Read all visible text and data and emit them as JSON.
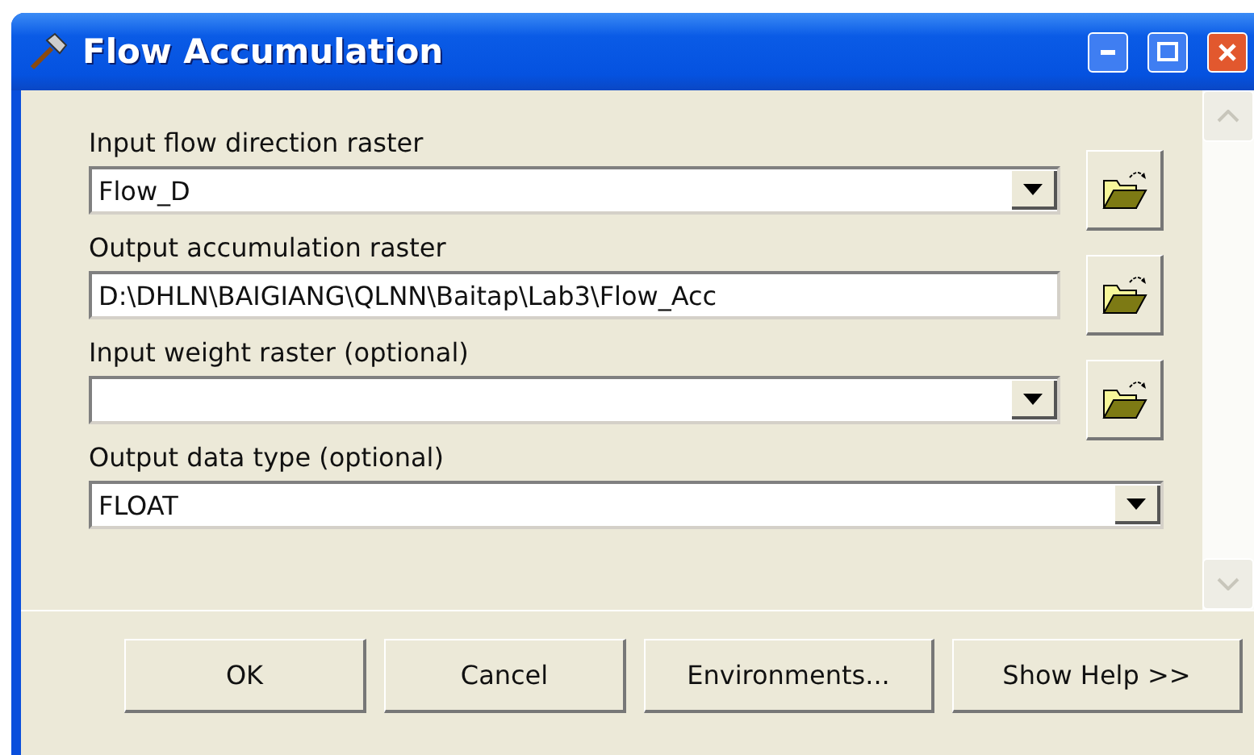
{
  "window": {
    "title": "Flow Accumulation"
  },
  "parameters": [
    {
      "label": "Input flow direction raster",
      "kind": "dropdown",
      "value": "Flow_D",
      "browse": true
    },
    {
      "label": "Output accumulation raster",
      "kind": "text",
      "value": "D:\\DHLN\\BAIGIANG\\QLNN\\Baitap\\Lab3\\Flow_Acc",
      "browse": true
    },
    {
      "label": "Input weight raster (optional)",
      "kind": "dropdown",
      "browse": true
    },
    {
      "label": "Output data type (optional)",
      "kind": "dropdown",
      "value": "FLOAT",
      "browse": false
    }
  ],
  "buttons": [
    "OK",
    "Cancel",
    "Environments...",
    "Show Help >>"
  ]
}
